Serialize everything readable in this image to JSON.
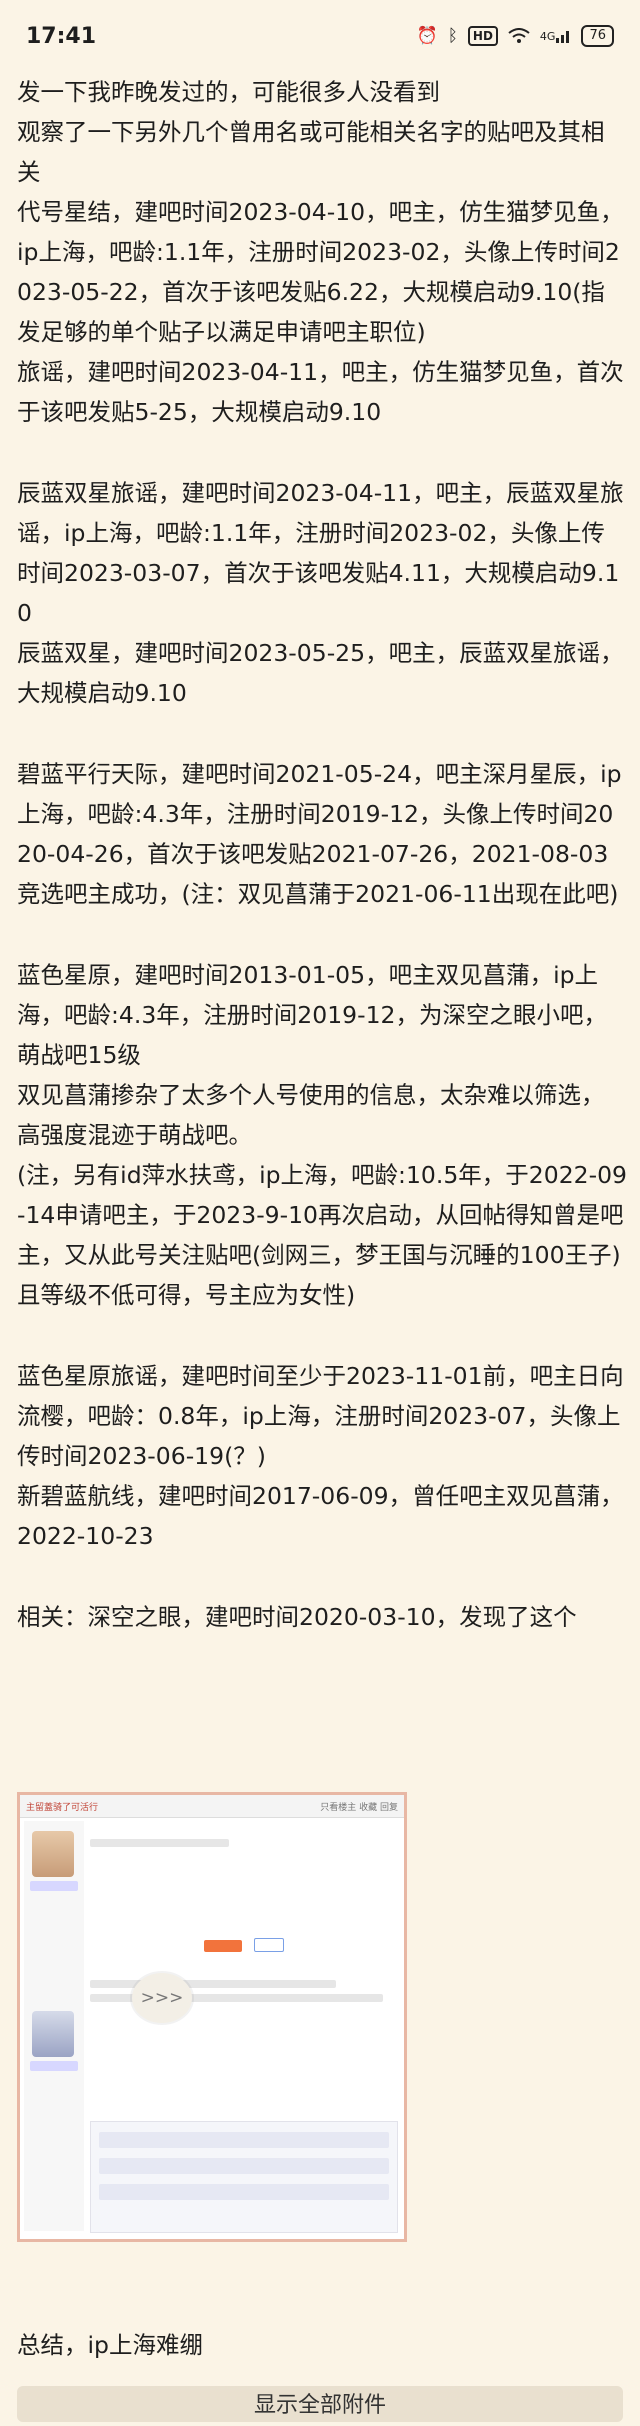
{
  "status_bar": {
    "time": "17:41",
    "icons": [
      "alarm-icon",
      "bluetooth-icon",
      "hd-icon",
      "wifi-icon",
      "signal-icon",
      "battery-icon"
    ],
    "hd_label": "HD",
    "signal_label": "4G",
    "battery_level": "76"
  },
  "paragraphs": [
    "发一下我昨晚发过的，可能很多人没看到",
    "观察了一下另外几个曾用名或可能相关名字的贴吧及其相关",
    "代号星结，建吧时间2023-04-10，吧主，仿生猫梦见鱼，ip上海，吧龄:1.1年，注册时间2023-02，头像上传时间2023-05-22，首次于该吧发贴6.22，大规模启动9.10(指发足够的单个贴子以满足申请吧主职位)",
    "旅谣，建吧时间2023-04-11，吧主，仿生猫梦见鱼，首次于该吧发贴5-25，大规模启动9.10",
    "",
    "辰蓝双星旅谣，建吧时间2023-04-11，吧主，辰蓝双星旅谣，ip上海，吧龄:1.1年，注册时间2023-02，头像上传时间2023-03-07，首次于该吧发贴4.11，大规模启动9.10",
    "辰蓝双星，建吧时间2023-05-25，吧主，辰蓝双星旅谣，大规模启动9.10",
    "",
    "碧蓝平行天际，建吧时间2021-05-24，吧主深月星辰，ip上海，吧龄:4.3年，注册时间2019-12，头像上传时间2020-04-26，首次于该吧发贴2021-07-26，2021-08-03竞选吧主成功，(注：双见菖蒲于2021-06-11出现在此吧)",
    "",
    "蓝色星原，建吧时间2013-01-05，吧主双见菖蒲，ip上海，吧龄:4.3年，注册时间2019-12，为深空之眼小吧，萌战吧15级",
    "双见菖蒲掺杂了太多个人号使用的信息，太杂难以筛选，高强度混迹于萌战吧。",
    "(注，另有id萍水扶鸢，ip上海，吧龄:10.5年，于2022-09-14申请吧主，于2023-9-10再次启动，从回帖得知曾是吧主，又从此号关注贴吧(剑网三，梦王国与沉睡的100王子)且等级不低可得，号主应为女性)",
    "",
    "蓝色星原旅谣，建吧时间至少于2023-11-01前，吧主日向流樱，吧龄：0.8年，ip上海，注册时间2023-07，头像上传时间2023-06-19(？)",
    "新碧蓝航线，建吧时间2017-06-09，曾任吧主双见菖蒲，2022-10-23",
    "",
    "相关：深空之眼，建吧时间2020-03-10，发现了这个"
  ],
  "attachment": {
    "header_left": "主留蓋骑了可活行",
    "header_right": "只看楼主  收藏  回复",
    "more_label": ">>>"
  },
  "summary": "总结，ip上海难绷",
  "show_all_button": "显示全部附件"
}
